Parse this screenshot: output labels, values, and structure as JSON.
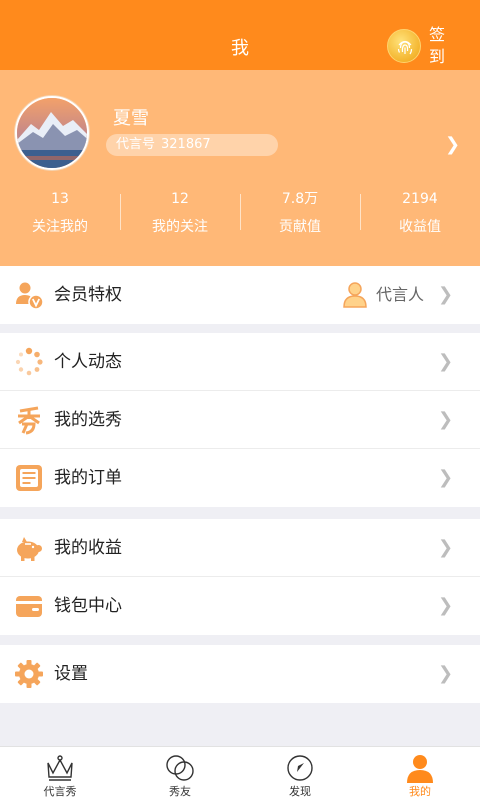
{
  "header": {
    "title": "我",
    "signin_label": "签到",
    "signin_icon": "fingerprint-icon"
  },
  "profile": {
    "name": "夏雪",
    "id_label": "代言号",
    "id_value": "321867",
    "stats": [
      {
        "value": "13",
        "label": "关注我的"
      },
      {
        "value": "12",
        "label": "我的关注"
      },
      {
        "value": "7.8万",
        "label": "贡献值"
      },
      {
        "value": "2194",
        "label": "收益值"
      }
    ]
  },
  "menu": {
    "vip": {
      "label": "会员特权",
      "status": "代言人",
      "icon": "vip-user-icon"
    },
    "personal_dynamics": {
      "label": "个人动态",
      "icon": "loading-dots-icon"
    },
    "my_shows": {
      "label": "我的选秀",
      "icon": "show-character-icon"
    },
    "my_orders": {
      "label": "我的订单",
      "icon": "order-list-icon"
    },
    "my_earnings": {
      "label": "我的收益",
      "icon": "piggy-bank-icon"
    },
    "wallet": {
      "label": "钱包中心",
      "icon": "wallet-icon"
    },
    "settings": {
      "label": "设置",
      "icon": "gear-icon"
    }
  },
  "tabs": [
    {
      "label": "代言秀",
      "icon": "crown-icon"
    },
    {
      "label": "秀友",
      "icon": "friends-circles-icon"
    },
    {
      "label": "发现",
      "icon": "compass-icon"
    },
    {
      "label": "我的",
      "icon": "person-icon",
      "active": true
    }
  ],
  "colors": {
    "accent": "#ff8a1c",
    "profile_bg": "#ffb877",
    "icon": "#f5a55b"
  }
}
